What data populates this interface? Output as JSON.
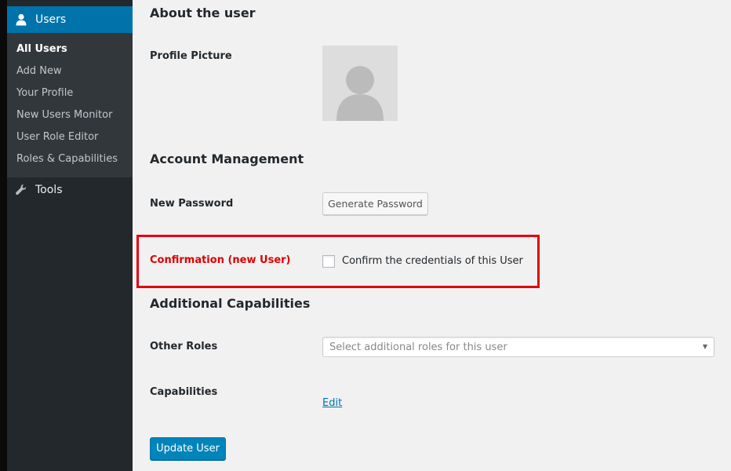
{
  "sidebar": {
    "users_label": "Users",
    "items": [
      {
        "label": "All Users",
        "current": true
      },
      {
        "label": "Add New"
      },
      {
        "label": "Your Profile"
      },
      {
        "label": "New Users Monitor"
      },
      {
        "label": "User Role Editor"
      },
      {
        "label": "Roles & Capabilities"
      }
    ],
    "tools_label": "Tools"
  },
  "about": {
    "heading": "About the user",
    "profile_picture_label": "Profile Picture"
  },
  "account": {
    "heading": "Account Management",
    "new_password_label": "New Password",
    "generate_button": "Generate Password"
  },
  "confirmation": {
    "label": "Confirmation (new User)",
    "checkbox_label": "Confirm the credentials of this User",
    "checked": false
  },
  "capabilities": {
    "heading": "Additional Capabilities",
    "other_roles_label": "Other Roles",
    "other_roles_placeholder": "Select additional roles for this user",
    "capabilities_label": "Capabilities",
    "edit_link": "Edit"
  },
  "update_button": "Update User",
  "colors": {
    "accent": "#0073aa",
    "primary_button": "#0085ba",
    "highlight_border": "#e3000f",
    "label_red": "#dd0000"
  }
}
